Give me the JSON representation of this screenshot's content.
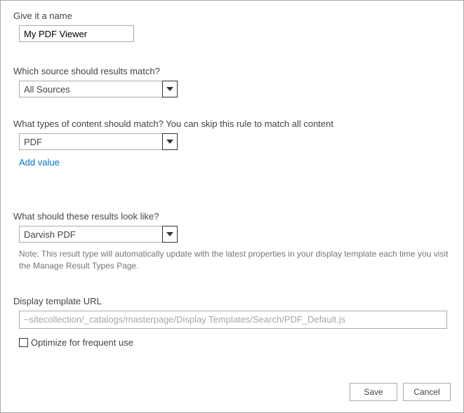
{
  "name_section": {
    "label": "Give it a name",
    "value": "My PDF Viewer"
  },
  "source_section": {
    "label": "Which source should results match?",
    "selected": "All Sources"
  },
  "content_section": {
    "label": "What types of content should match? You can skip this rule to match all content",
    "selected": "PDF",
    "add_value_link": "Add value"
  },
  "look_section": {
    "label": "What should these results look like?",
    "selected": "Darvish PDF",
    "note": "Note: This result type will automatically update with the latest properties in your display template each time you visit the Manage Result Types Page."
  },
  "url_section": {
    "label": "Display template URL",
    "value": "~sitecollection/_catalogs/masterpage/Display Templates/Search/PDF_Default.js",
    "optimize_label": "Optimize for frequent use"
  },
  "buttons": {
    "save": "Save",
    "cancel": "Cancel"
  }
}
